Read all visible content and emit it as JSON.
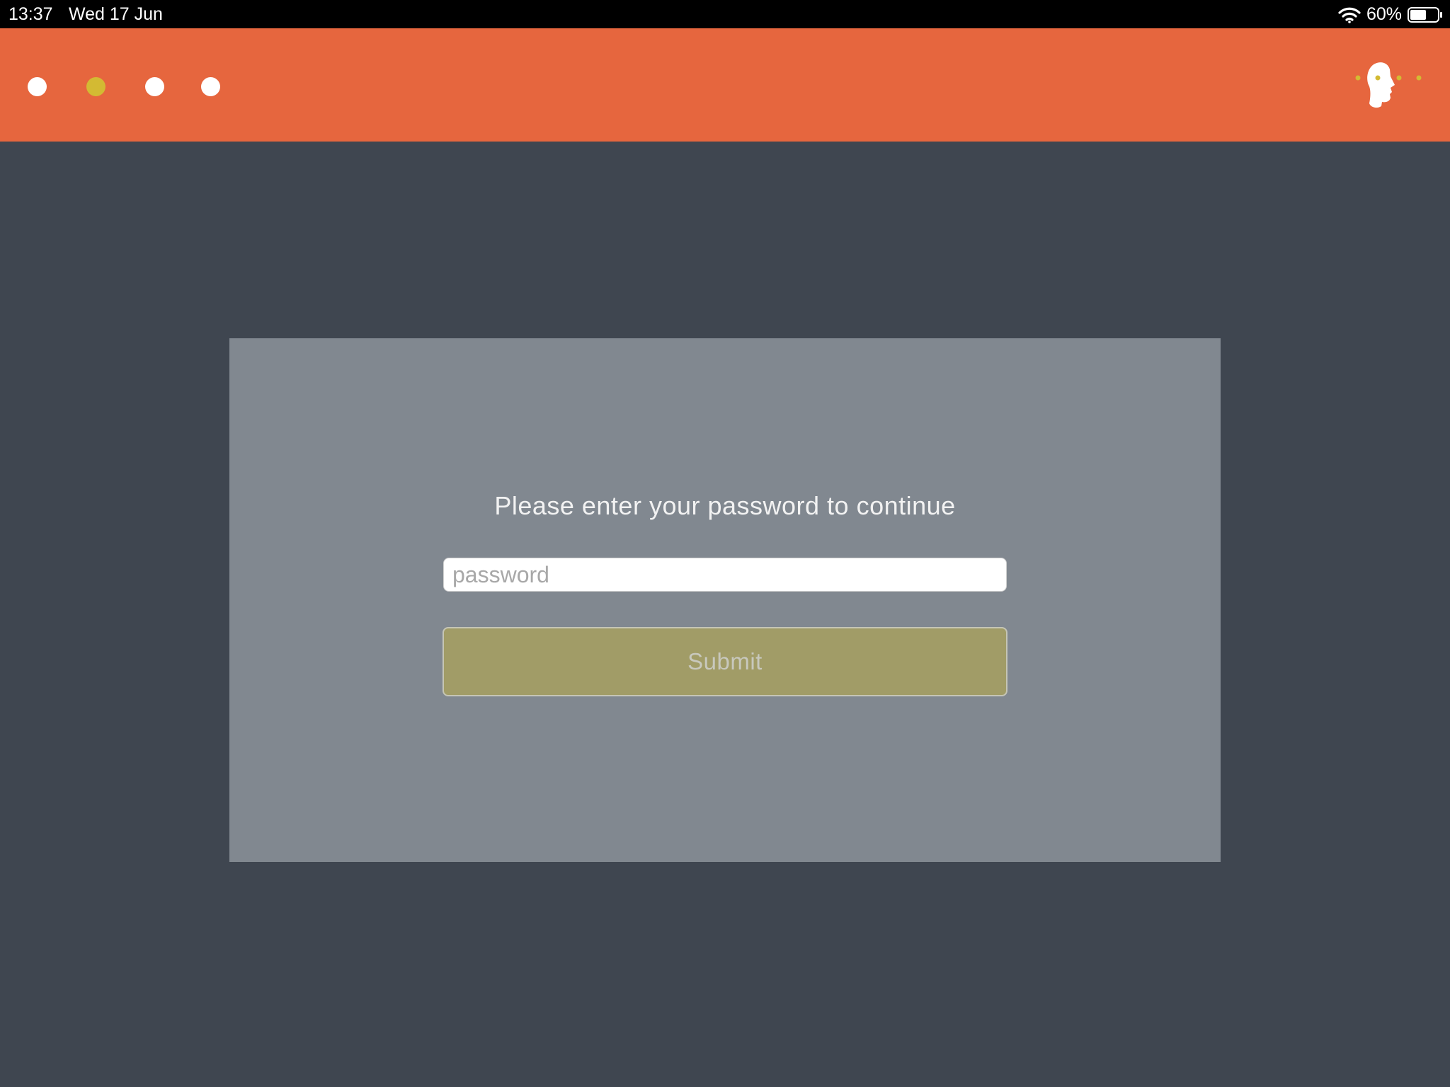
{
  "status_bar": {
    "time": "13:37",
    "date": "Wed 17 Jun",
    "battery_percent": "60%",
    "battery_level": 0.6,
    "icons": [
      "wifi-icon",
      "battery-icon"
    ]
  },
  "header": {
    "page_indicator": {
      "count": 4,
      "active_index": 1
    },
    "logo_icon": "head-profile-logo-icon",
    "colors": {
      "background": "#e6663e",
      "dot": "#ffffff",
      "dot_active": "#d3ba33"
    }
  },
  "login": {
    "prompt": "Please enter your password to continue",
    "password_placeholder": "password",
    "password_value": "",
    "submit_label": "Submit"
  },
  "colors": {
    "page_background": "#3f4650",
    "card_background": "#818890",
    "submit_background": "#a19c67"
  }
}
